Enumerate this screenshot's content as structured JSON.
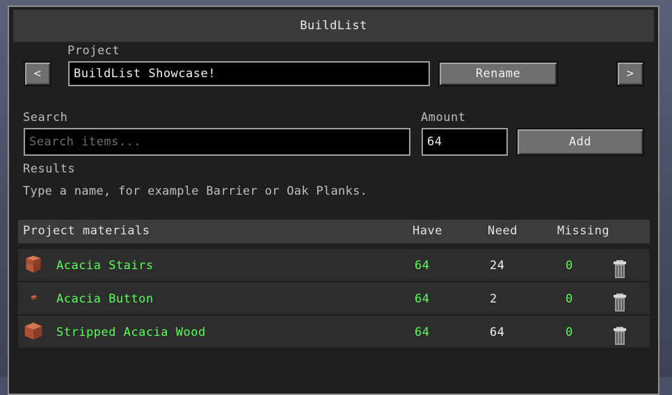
{
  "window": {
    "title": "BuildList"
  },
  "project": {
    "label": "Project",
    "name": "BuildList Showcase!",
    "prev_label": "<",
    "next_label": ">",
    "rename_label": "Rename"
  },
  "search": {
    "label": "Search",
    "placeholder": "Search items..."
  },
  "amount": {
    "label": "Amount",
    "value": "64"
  },
  "add_label": "Add",
  "results": {
    "label": "Results",
    "hint": "Type a name, for example Barrier or Oak Planks."
  },
  "table": {
    "headers": {
      "materials": "Project materials",
      "have": "Have",
      "need": "Need",
      "missing": "Missing"
    },
    "rows": [
      {
        "name": "Acacia Stairs",
        "have": "64",
        "need": "24",
        "missing": "0",
        "icon": "acacia-stairs-icon"
      },
      {
        "name": "Acacia Button",
        "have": "64",
        "need": "2",
        "missing": "0",
        "icon": "acacia-button-icon"
      },
      {
        "name": "Stripped Acacia Wood",
        "have": "64",
        "need": "64",
        "missing": "0",
        "icon": "stripped-acacia-wood-icon"
      }
    ]
  },
  "colors": {
    "present": "#55ff55",
    "panel": "#242424",
    "accent_wood": "#b8573a"
  }
}
